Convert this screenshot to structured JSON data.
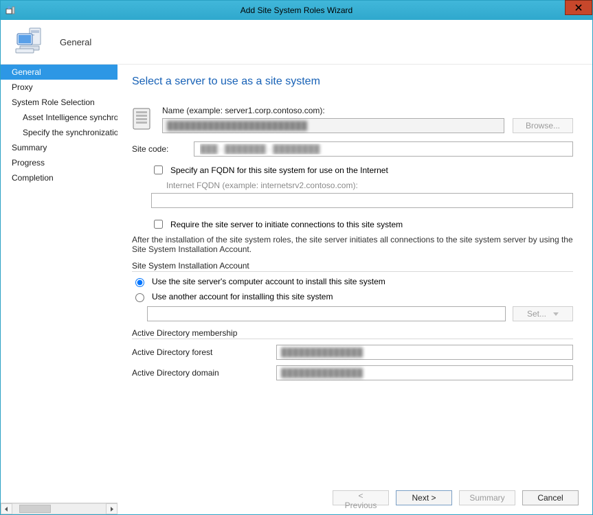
{
  "window": {
    "title": "Add Site System Roles Wizard"
  },
  "header": {
    "section_label": "General"
  },
  "sidebar": {
    "steps": [
      {
        "label": "General",
        "selected": true,
        "indent": false
      },
      {
        "label": "Proxy",
        "selected": false,
        "indent": false
      },
      {
        "label": "System Role Selection",
        "selected": false,
        "indent": false
      },
      {
        "label": "Asset Intelligence synchronization point",
        "selected": false,
        "indent": true
      },
      {
        "label": "Specify the synchronization schedule",
        "selected": false,
        "indent": true
      },
      {
        "label": "Summary",
        "selected": false,
        "indent": false
      },
      {
        "label": "Progress",
        "selected": false,
        "indent": false
      },
      {
        "label": "Completion",
        "selected": false,
        "indent": false
      }
    ]
  },
  "main": {
    "page_title": "Select a server to use as a site system",
    "name_label": "Name (example: server1.corp.contoso.com):",
    "name_value": "████████████████████████",
    "browse_btn": "Browse...",
    "sitecode_label": "Site code:",
    "sitecode_value": "███ - ███████ - ████████",
    "fqdn_checkbox": "Specify an FQDN for this site system for use on the Internet",
    "fqdn_checked": false,
    "internet_fqdn_label": "Internet FQDN (example: internetsrv2.contoso.com):",
    "internet_fqdn_value": "",
    "require_conn_checkbox": "Require the site server to initiate connections to this site system",
    "require_conn_checked": false,
    "install_note": "After the  installation of the site system roles, the site server initiates all connections to the site system server by using the Site System Installation Account.",
    "ssia_group_title": "Site System Installation Account",
    "radio_computer_account": "Use the site server's computer account to install this site system",
    "radio_other_account": "Use another account for installing this site system",
    "radio_selected": "computer",
    "other_account_value": "",
    "set_btn": "Set...",
    "ad_group_title": "Active Directory membership",
    "ad_forest_label": "Active Directory forest",
    "ad_forest_value": "██████████████",
    "ad_domain_label": "Active Directory domain",
    "ad_domain_value": "██████████████"
  },
  "footer": {
    "previous": "< Previous",
    "next": "Next >",
    "summary": "Summary",
    "cancel": "Cancel"
  }
}
